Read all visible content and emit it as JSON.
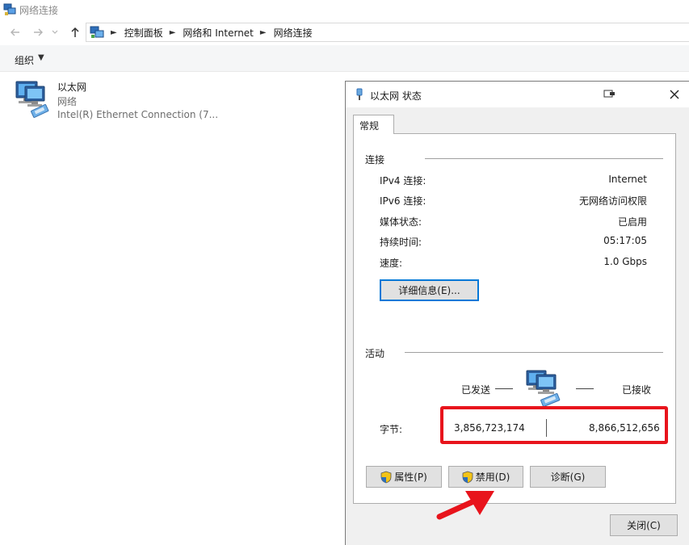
{
  "explorer": {
    "window_title": "网络连接",
    "breadcrumb": [
      "控制面板",
      "网络和 Internet",
      "网络连接"
    ],
    "toolbar": {
      "organize_label": "组织"
    },
    "items": [
      {
        "name": "以太网",
        "subtitle": "网络",
        "device": "Intel(R) Ethernet Connection (7..."
      }
    ]
  },
  "dialog": {
    "title": "以太网 状态",
    "tab": "常规",
    "connection": {
      "section_label": "连接",
      "rows": [
        {
          "label": "IPv4 连接:",
          "value": "Internet"
        },
        {
          "label": "IPv6 连接:",
          "value": "无网络访问权限"
        },
        {
          "label": "媒体状态:",
          "value": "已启用"
        },
        {
          "label": "持续时间:",
          "value": "05:17:05"
        },
        {
          "label": "速度:",
          "value": "1.0 Gbps"
        }
      ],
      "details_button": "详细信息(E)..."
    },
    "activity": {
      "section_label": "活动",
      "sent_label": "已发送",
      "received_label": "已接收",
      "bytes_label": "字节:",
      "bytes_sent": "3,856,723,174",
      "bytes_received": "8,866,512,656"
    },
    "buttons": {
      "properties": "属性(P)",
      "disable": "禁用(D)",
      "diagnose": "诊断(G)",
      "close": "关闭(C)"
    }
  },
  "colors": {
    "accent": "#0078d7",
    "highlight": "#e8141c"
  }
}
